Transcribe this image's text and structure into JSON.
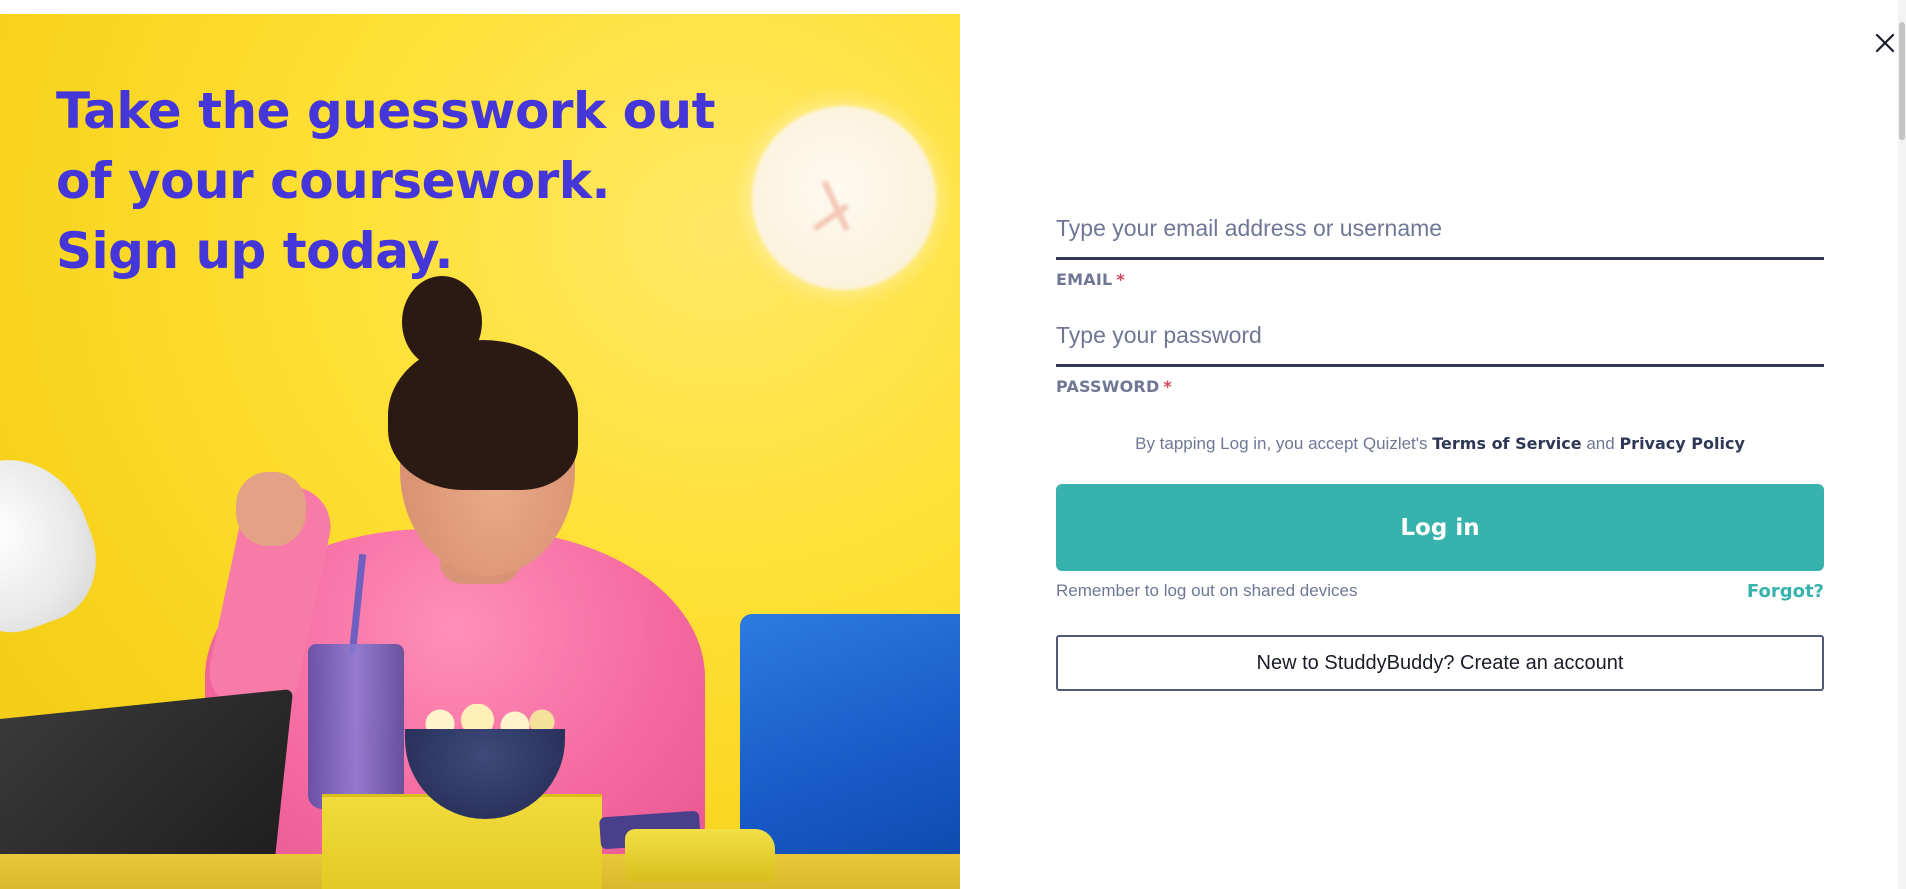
{
  "hero": {
    "headline_lines": [
      "Take the guesswork out",
      "of your coursework.",
      "Sign up today."
    ],
    "accent_color": "#4436d8",
    "background_color": "#ffe138"
  },
  "window": {
    "close_icon": "close-icon"
  },
  "login_form": {
    "email": {
      "placeholder": "Type your email address or username",
      "value": "",
      "label": "EMAIL",
      "required_mark": "*"
    },
    "password": {
      "placeholder": "Type your password",
      "value": "",
      "label": "PASSWORD",
      "required_mark": "*"
    },
    "terms": {
      "prefix": "By tapping Log in, you accept Quizlet's",
      "terms_link": "Terms of Service",
      "conjunction": "and",
      "privacy_link": "Privacy Policy"
    },
    "login_button": "Log in",
    "remember_text": "Remember to log out on shared devices",
    "forgot_link": "Forgot?",
    "create_account_button": "New to StuddyBuddy? Create an account",
    "colors": {
      "primary": "#38b2ac",
      "text_dark": "#2e3856",
      "text_muted": "#6f7795",
      "required": "#d9455f"
    }
  }
}
